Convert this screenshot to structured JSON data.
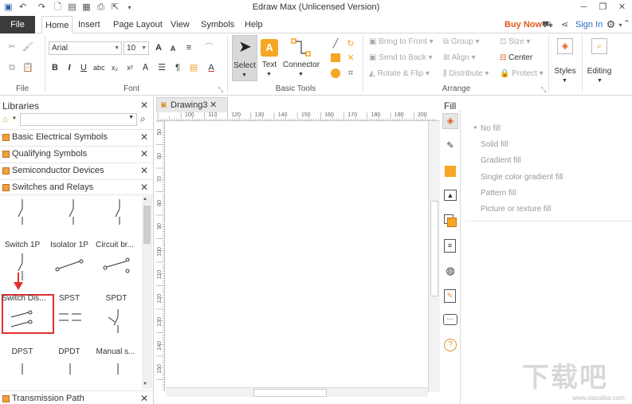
{
  "window": {
    "title": "Edraw Max (Unlicensed Version)"
  },
  "menu": {
    "file": "File",
    "tabs": [
      "Home",
      "Insert",
      "Page Layout",
      "View",
      "Symbols",
      "Help"
    ],
    "buy_now": "Buy Now",
    "sign_in": "Sign In"
  },
  "ribbon": {
    "groups": {
      "file": "File",
      "font": "Font",
      "basic_tools": "Basic Tools",
      "arrange": "Arrange"
    },
    "font_name": "Arial",
    "font_size": "10",
    "tools": {
      "select": "Select",
      "text": "Text",
      "connector": "Connector"
    },
    "arrange_items": {
      "bring_to_front": "Bring to Front",
      "send_to_back": "Send to Back",
      "rotate_flip": "Rotate & Flip",
      "group": "Group",
      "align": "Align",
      "distribute": "Distribute",
      "size": "Size",
      "center": "Center",
      "protect": "Protect"
    },
    "styles": "Styles",
    "editing": "Editing"
  },
  "libraries": {
    "title": "Libraries",
    "items": [
      "Basic Electrical Symbols",
      "Qualifying Symbols",
      "Semiconductor Devices",
      "Switches and Relays"
    ],
    "shapes": [
      "Switch 1P",
      "Isolator 1P",
      "Circuit br...",
      "Switch Dis...",
      "SPST",
      "SPDT",
      "DPST",
      "DPDT",
      "Manual s..."
    ],
    "bottom_item": "Transmission Path"
  },
  "canvas": {
    "tab": "Drawing3",
    "ruler_h": [
      "100",
      "110",
      "120",
      "130",
      "140",
      "150",
      "160",
      "170",
      "180",
      "190",
      "200"
    ],
    "ruler_v": [
      "50",
      "60",
      "70",
      "80",
      "90",
      "100",
      "110",
      "120",
      "130",
      "140",
      "150"
    ]
  },
  "fill_panel": {
    "title": "Fill",
    "options": [
      "No fill",
      "Solid fill",
      "Gradient fill",
      "Single color gradient fill",
      "Pattern fill",
      "Picture or texture fill"
    ]
  },
  "watermark": {
    "text": "下载吧",
    "url": "www.xiazaiba.com"
  },
  "colors": {
    "accent": "#f5a623",
    "file_tab": "#3b3b3b",
    "highlight_box": "#e03030",
    "buy_now": "#e05a1a"
  }
}
